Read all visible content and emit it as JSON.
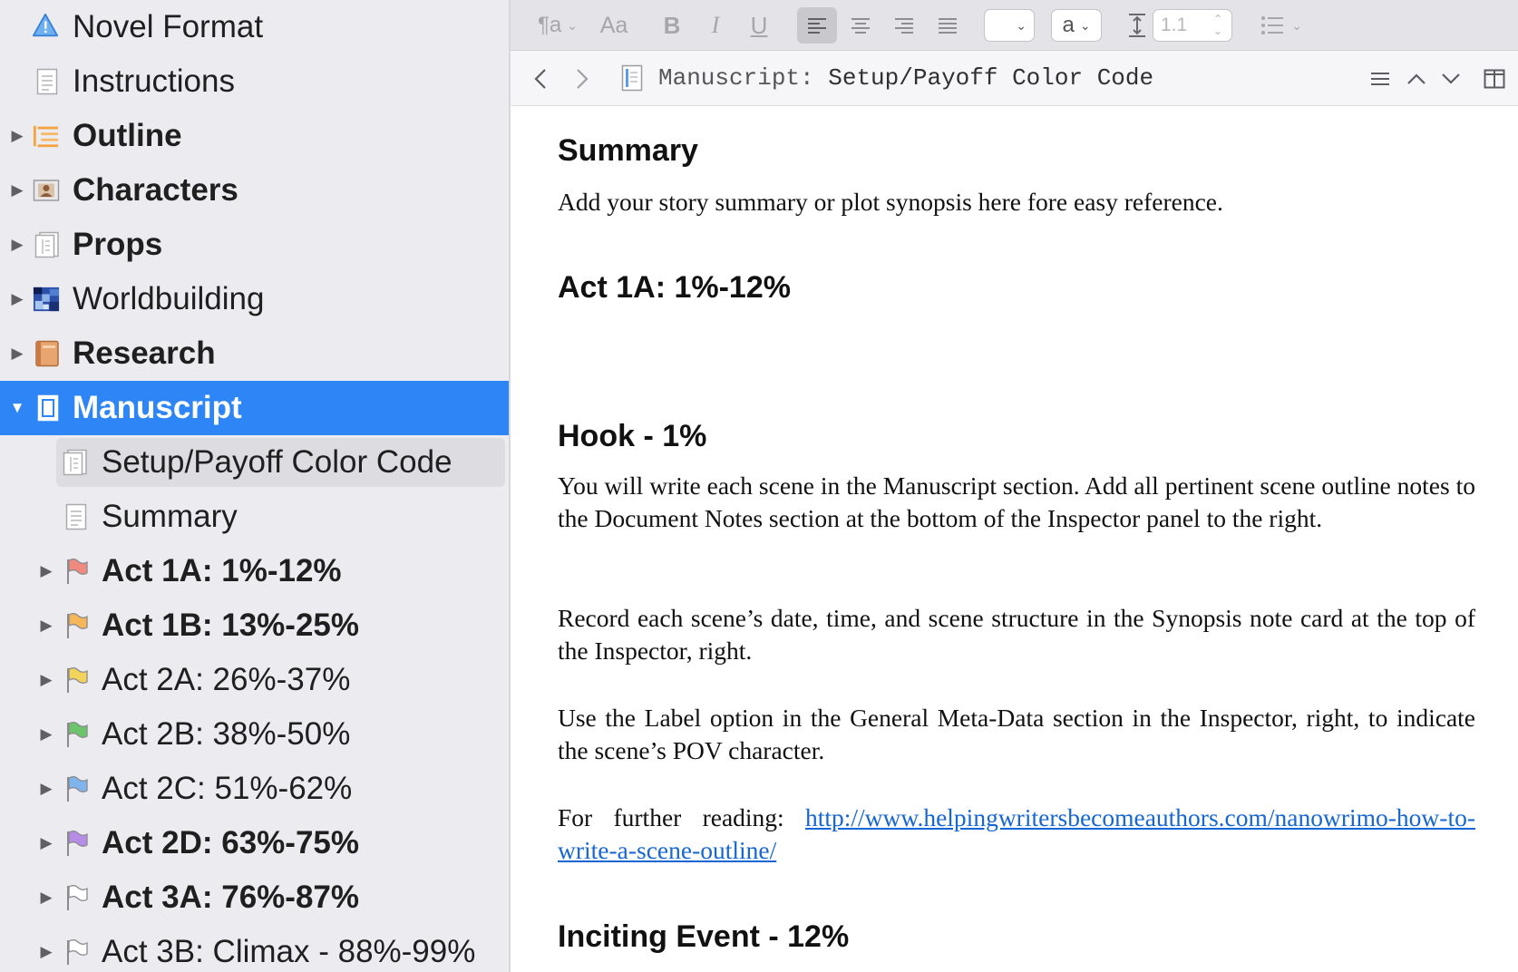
{
  "binder": {
    "items": [
      {
        "label": "Novel Format",
        "icon": "warning-triangle-icon",
        "bold": false
      },
      {
        "label": "Instructions",
        "icon": "document-icon",
        "bold": false
      },
      {
        "label": "Outline",
        "icon": "outline-list-icon",
        "bold": true
      },
      {
        "label": "Characters",
        "icon": "character-card-icon",
        "bold": true
      },
      {
        "label": "Props",
        "icon": "folder-doc-icon",
        "bold": true
      },
      {
        "label": "Worldbuilding",
        "icon": "map-image-icon",
        "bold": false
      },
      {
        "label": "Research",
        "icon": "book-icon",
        "bold": true
      },
      {
        "label": "Manuscript",
        "icon": "manuscript-icon",
        "bold": true,
        "selected": true
      },
      {
        "label": "Setup/Payoff Color Code",
        "icon": "folder-doc-icon",
        "bold": false
      },
      {
        "label": "Summary",
        "icon": "document-icon",
        "bold": false
      },
      {
        "label": "Act 1A: 1%-12%",
        "icon": "flag-icon",
        "flag_color": "#f08a7e",
        "bold": true
      },
      {
        "label": "Act 1B: 13%-25%",
        "icon": "flag-icon",
        "flag_color": "#f6b65a",
        "bold": true
      },
      {
        "label": "Act 2A: 26%-37%",
        "icon": "flag-icon",
        "flag_color": "#f3d35a",
        "bold": false
      },
      {
        "label": "Act 2B: 38%-50%",
        "icon": "flag-icon",
        "flag_color": "#6cc56a",
        "bold": false
      },
      {
        "label": "Act 2C: 51%-62%",
        "icon": "flag-icon",
        "flag_color": "#7fb5ec",
        "bold": false
      },
      {
        "label": "Act 2D: 63%-75%",
        "icon": "flag-icon",
        "flag_color": "#b78ce8",
        "bold": true
      },
      {
        "label": "Act 3A: 76%-87%",
        "icon": "flag-icon",
        "flag_color": "#ffffff",
        "bold": true
      },
      {
        "label": "Act 3B: Climax - 88%-99%",
        "icon": "flag-icon",
        "flag_color": "#ffffff",
        "bold": false
      }
    ]
  },
  "format_bar": {
    "paragraph_style_glyph": "¶a",
    "font_glyph": "Aa",
    "bold_glyph": "B",
    "italic_glyph": "I",
    "underline_glyph": "U",
    "font_size_value": "",
    "text_color_glyph": "a",
    "line_spacing_value": "1.1"
  },
  "header": {
    "title_prefix": "Manuscript:",
    "title": "Setup/Payoff Color Code"
  },
  "document": {
    "summary_heading": "Summary",
    "summary_text": "Add your story summary or plot synopsis here fore easy reference.",
    "act1a_heading": "Act 1A: 1%-12%",
    "hook_heading": "Hook - 1%",
    "hook_p1": "You will write each scene in the Manuscript section. Add all pertinent scene outline notes to the Document Notes section at the bottom of the Inspector panel to the right.",
    "hook_p2": "Record each scene’s date, time, and scene structure in the Synopsis note card at the top of the Inspector, right.",
    "hook_p3": "Use the Label option in the General Meta-Data section in the Inspector, right, to indicate the scene’s POV character.",
    "further_reading_label": "For further reading:",
    "further_reading_link": "http://www.helpingwritersbecomeauthors.com/nanowrimo-how-to-write-a-scene-outline/",
    "inciting_heading": "Inciting Event - 12%"
  },
  "colors": {
    "selection": "#2e86f6",
    "sidebar_bg": "#ececf0",
    "link": "#1666d3"
  }
}
